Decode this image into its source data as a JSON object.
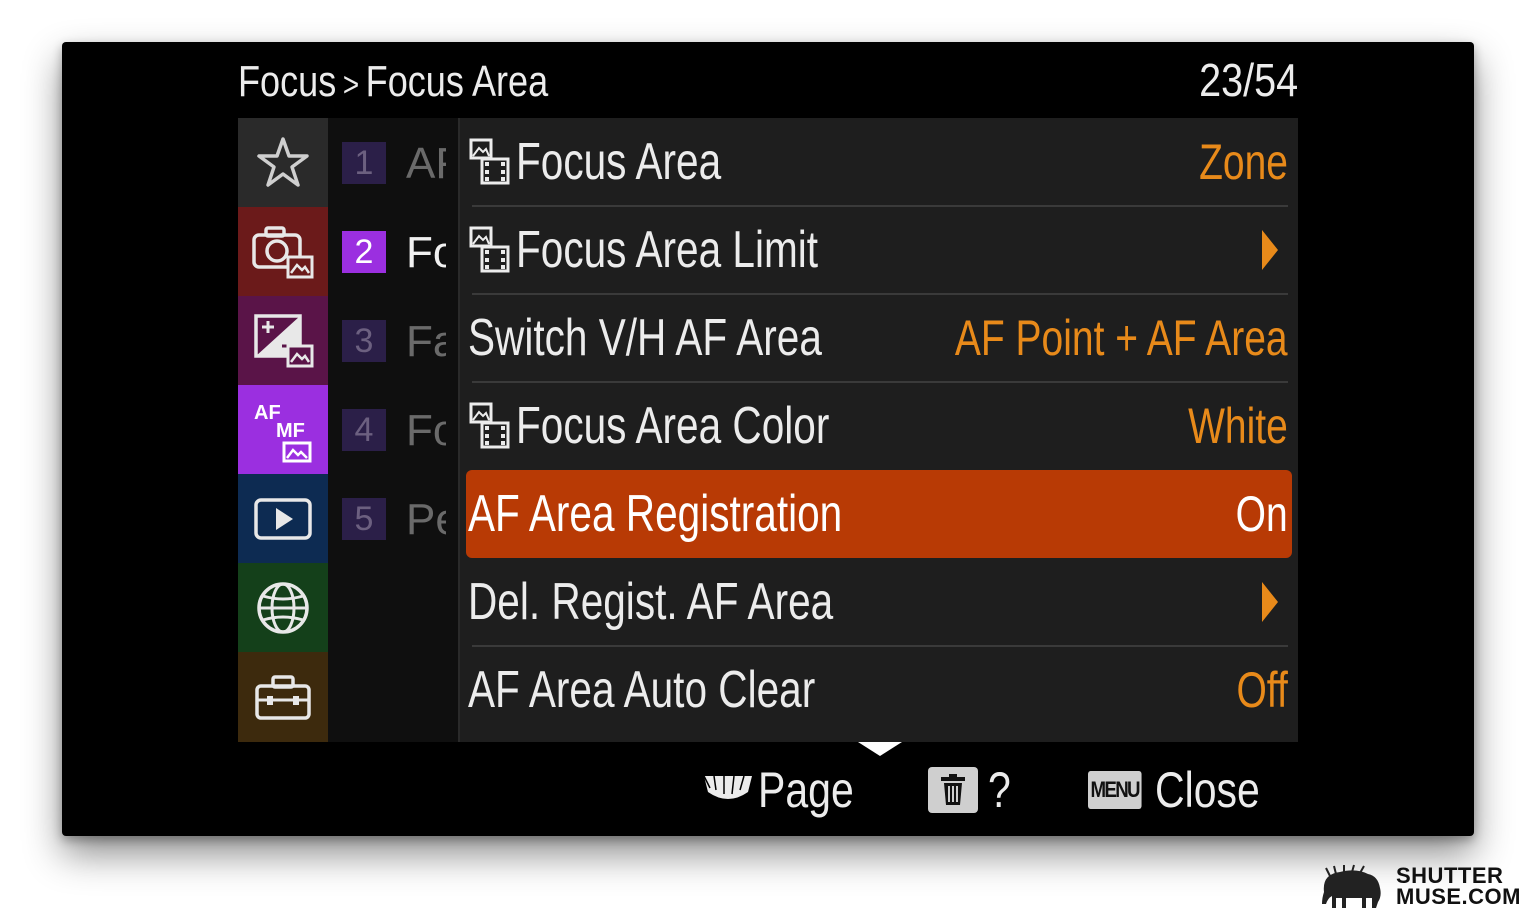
{
  "header": {
    "breadcrumb_section": "Focus",
    "breadcrumb_separator": ">",
    "breadcrumb_page": "Focus Area",
    "page_counter": "23/54"
  },
  "categories": [
    {
      "name": "favorites",
      "icon": "star-icon",
      "color": "#2a2a2a"
    },
    {
      "name": "shooting",
      "icon": "camera-icon",
      "color": "#6b1a1a"
    },
    {
      "name": "exposure",
      "icon": "exposure-icon",
      "color": "#5a1448"
    },
    {
      "name": "focus",
      "icon": "af-mf-icon",
      "color": "#9b2fe0",
      "label_top": "AF",
      "label_bottom": "MF"
    },
    {
      "name": "playback",
      "icon": "playback-icon",
      "color": "#0d2b52"
    },
    {
      "name": "network",
      "icon": "globe-icon",
      "color": "#14401a"
    },
    {
      "name": "setup",
      "icon": "toolbox-icon",
      "color": "#3d2a0d"
    }
  ],
  "pages": [
    {
      "number": "1",
      "title": "AF",
      "active": false
    },
    {
      "number": "2",
      "title": "Fo",
      "active": true
    },
    {
      "number": "3",
      "title": "Fa",
      "active": false
    },
    {
      "number": "4",
      "title": "Fo",
      "active": false
    },
    {
      "number": "5",
      "title": "Pe",
      "active": false
    }
  ],
  "menu_items": [
    {
      "label": "Focus Area",
      "value": "Zone",
      "has_icon": true,
      "arrow": false,
      "selected": false
    },
    {
      "label": "Focus Area Limit",
      "value": "",
      "has_icon": true,
      "arrow": true,
      "selected": false
    },
    {
      "label": "Switch V/H AF Area",
      "value": "AF Point + AF Area",
      "has_icon": false,
      "arrow": false,
      "selected": false
    },
    {
      "label": "Focus Area Color",
      "value": "White",
      "has_icon": true,
      "arrow": false,
      "selected": false
    },
    {
      "label": "AF Area Registration",
      "value": "On",
      "has_icon": false,
      "arrow": false,
      "selected": true
    },
    {
      "label": "Del. Regist. AF Area",
      "value": "",
      "has_icon": false,
      "arrow": true,
      "selected": false
    },
    {
      "label": "AF Area Auto Clear",
      "value": "Off",
      "has_icon": false,
      "arrow": false,
      "selected": false
    }
  ],
  "footer": {
    "page_label": "Page",
    "help_label": "?",
    "menu_key": "MENU",
    "close_label": "Close"
  },
  "watermark": {
    "line1": "SHUTTER",
    "line2": "MUSE.COM"
  },
  "colors": {
    "value_orange": "#e88a1a",
    "selected_bg": "#b83a05",
    "active_page_purple": "#9b2fe0"
  }
}
